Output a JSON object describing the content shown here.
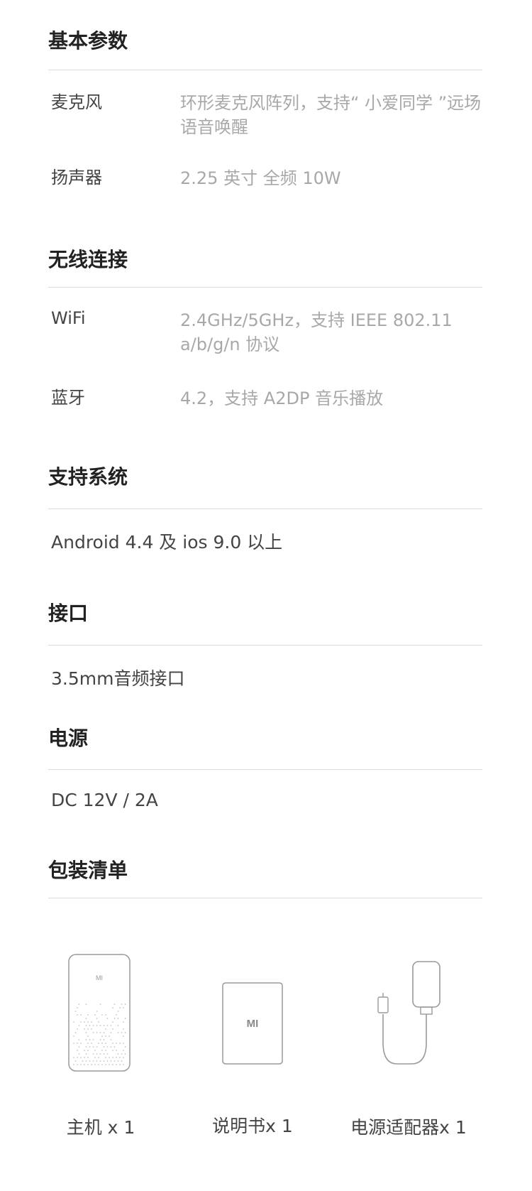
{
  "sections": {
    "basic": {
      "title": "基本参数",
      "rows": [
        {
          "label": "麦克风",
          "value": "环形麦克风阵列，支持“ 小爱同学 ”远场语音唤醒"
        },
        {
          "label": "扬声器",
          "value": "2.25 英寸  全频 10W"
        }
      ]
    },
    "wireless": {
      "title": "无线连接",
      "rows": [
        {
          "label": "WiFi",
          "value": "2.4GHz/5GHz，支持 IEEE 802.11 a/b/g/n 协议"
        },
        {
          "label": "蓝牙",
          "value": "4.2，支持 A2DP 音乐播放"
        }
      ]
    },
    "system": {
      "title": "支持系统",
      "value": "Android 4.4 及 ios 9.0 以上"
    },
    "port": {
      "title": "接口",
      "value": "3.5mm音频接口"
    },
    "power": {
      "title": "电源",
      "value": "DC 12V / 2A"
    },
    "package": {
      "title": "包装清单",
      "items": [
        {
          "label": "主机 x 1",
          "icon": "speaker-icon"
        },
        {
          "label": "说明书x 1",
          "icon": "manual-icon"
        },
        {
          "label": "电源适配器x 1",
          "icon": "power-adapter-icon"
        }
      ],
      "logo_text": "MI"
    }
  }
}
